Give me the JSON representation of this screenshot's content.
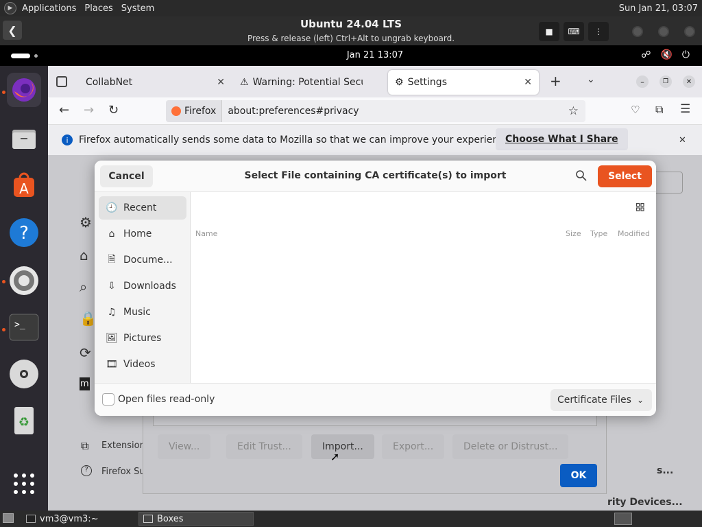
{
  "host_panel": {
    "menu": [
      "Applications",
      "Places",
      "System"
    ],
    "clock": "Sun Jan 21, 03:07"
  },
  "boxes": {
    "title": "Ubuntu 24.04 LTS",
    "subtitle": "Press & release (left) Ctrl+Alt to ungrab keyboard."
  },
  "guest_bar": {
    "clock": "Jan 21  13:07"
  },
  "firefox": {
    "tabs": [
      {
        "label": "CollabNet"
      },
      {
        "label": "Warning: Potential Securi"
      },
      {
        "label": "Settings"
      }
    ],
    "identity_label": "Firefox",
    "url": "about:preferences#privacy",
    "notice_text": "Firefox automatically sends some data to Mozilla so that we can improve your experience.",
    "notice_button": "Choose What I Share",
    "sidebar_bottom": [
      "Extension",
      "Firefox Su"
    ],
    "right_links": [
      "s...",
      "rity Devices..."
    ]
  },
  "cert_manager": {
    "buttons": [
      "View...",
      "Edit Trust...",
      "Import...",
      "Export...",
      "Delete or Distrust..."
    ],
    "ok": "OK"
  },
  "dialog": {
    "cancel": "Cancel",
    "title": "Select File containing CA certificate(s) to import",
    "select": "Select",
    "places": [
      {
        "label": "Recent",
        "icon": "clock-icon"
      },
      {
        "label": "Home",
        "icon": "home-icon"
      },
      {
        "label": "Docume...",
        "icon": "document-icon"
      },
      {
        "label": "Downloads",
        "icon": "download-icon"
      },
      {
        "label": "Music",
        "icon": "music-icon"
      },
      {
        "label": "Pictures",
        "icon": "picture-icon"
      },
      {
        "label": "Videos",
        "icon": "video-icon"
      }
    ],
    "columns": {
      "name": "Name",
      "size": "Size",
      "type": "Type",
      "modified": "Modified"
    },
    "read_only_label": "Open files read-only",
    "filter": "Certificate Files"
  },
  "taskbar": {
    "tasks": [
      "vm3@vm3:~",
      "Boxes"
    ]
  },
  "colors": {
    "accent": "#e95420",
    "ok_button": "#0a5cc2"
  }
}
